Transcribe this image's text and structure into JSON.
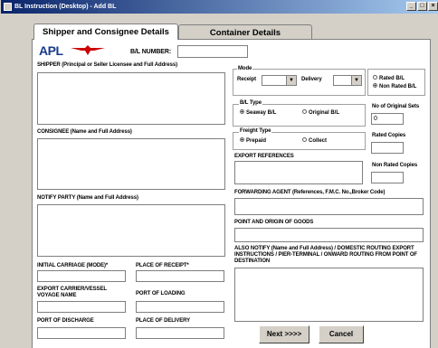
{
  "window": {
    "title": "BL Instruction (Desktop) - Add BL"
  },
  "title_buttons": [
    "_",
    "□",
    "×"
  ],
  "tabs": [
    {
      "label": "Shipper and Consignee Details"
    },
    {
      "label": "Container Details"
    }
  ],
  "brand": {
    "name": "APL",
    "logo_color": "#cc0000"
  },
  "bl_number": {
    "label": "B/L NUMBER:",
    "value": ""
  },
  "left": {
    "shipper": "SHIPPER (Principal or Seller Licensee and Full Address)",
    "consignee": "CONSIGNEE (Name and Full Address)",
    "notify": "NOTIFY PARTY (Name and Full Address)",
    "initial_carriage": "INITIAL CARRIAGE (MODE)*",
    "place_of_receipt": "PLACE OF RECEIPT*",
    "export_carrier": "EXPORT CARRIER/VESSEL VOYAGE NAME",
    "port_of_loading": "PORT OF LOADING",
    "port_of_discharge": "PORT OF DISCHARGE",
    "place_of_delivery": "PLACE OF DELIVERY"
  },
  "mode": {
    "title": "Mode",
    "receipt_label": "Receipt",
    "delivery_label": "Delivery",
    "receipt_value": "",
    "delivery_value": ""
  },
  "rated": {
    "rated_label": "Rated B/L",
    "non_rated_label": "Non Rated B/L",
    "selected": "Non Rated B/L"
  },
  "bl_type": {
    "title": "B/L Type",
    "seaway": "Seaway B/L",
    "original": "Original B/L",
    "selected": "Seaway B/L"
  },
  "original_sets": {
    "label": "No of Original Sets",
    "value": "0"
  },
  "freight": {
    "title": "Freight Type",
    "prepaid": "Prepaid",
    "collect": "Collect",
    "selected": "Prepaid"
  },
  "rated_copies": {
    "label": "Rated Copies",
    "value": ""
  },
  "non_rated_copies": {
    "label": "Non Rated Copies",
    "value": ""
  },
  "right": {
    "export_references": "EXPORT REFERENCES",
    "forwarding_agent": "FORWARDING AGENT (References, F.M.C. No.,Broker Code)",
    "point_origin": "POINT AND ORIGIN OF GOODS",
    "also_notify": "ALSO NOTIFY (Name and Full Address) / DOMESTIC ROUTING EXPORT INSTRUCTIONS / PIER-TERMINAL / ONWARD ROUTING FROM POINT OF DESTINATION"
  },
  "buttons": {
    "next": "Next >>>>",
    "cancel": "Cancel"
  }
}
